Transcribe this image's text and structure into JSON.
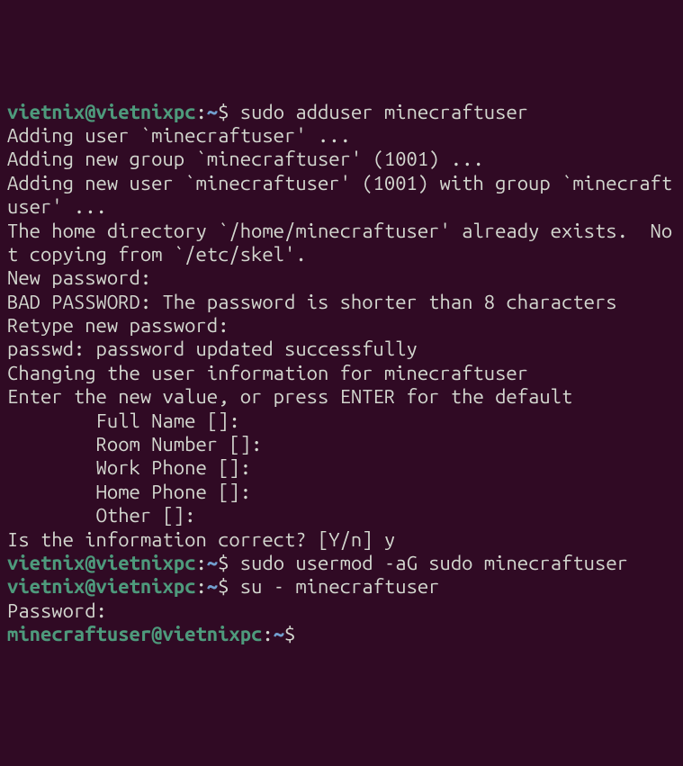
{
  "prompts": [
    {
      "user_host": "vietnix@vietnixpc",
      "path": "~",
      "symbol": "$",
      "command": "sudo adduser minecraftuser"
    },
    {
      "user_host": "vietnix@vietnixpc",
      "path": "~",
      "symbol": "$",
      "command": "sudo usermod -aG sudo minecraftuser"
    },
    {
      "user_host": "vietnix@vietnixpc",
      "path": "~",
      "symbol": "$",
      "command": "su - minecraftuser"
    },
    {
      "user_host": "minecraftuser@vietnixpc",
      "path": "~",
      "symbol": "$",
      "command": ""
    }
  ],
  "output": {
    "l1": "Adding user `minecraftuser' ...",
    "l2": "Adding new group `minecraftuser' (1001) ...",
    "l3": "Adding new user `minecraftuser' (1001) with group `minecraftuser' ...",
    "l4": "The home directory `/home/minecraftuser' already exists.  Not copying from `/etc/skel'.",
    "l5": "New password:",
    "l6": "BAD PASSWORD: The password is shorter than 8 characters",
    "l7": "Retype new password:",
    "l8": "passwd: password updated successfully",
    "l9": "Changing the user information for minecraftuser",
    "l10": "Enter the new value, or press ENTER for the default",
    "l11": "        Full Name []:",
    "l12": "        Room Number []:",
    "l13": "        Work Phone []:",
    "l14": "        Home Phone []:",
    "l15": "        Other []:",
    "l16": "Is the information correct? [Y/n] y",
    "l17": "Password:"
  }
}
